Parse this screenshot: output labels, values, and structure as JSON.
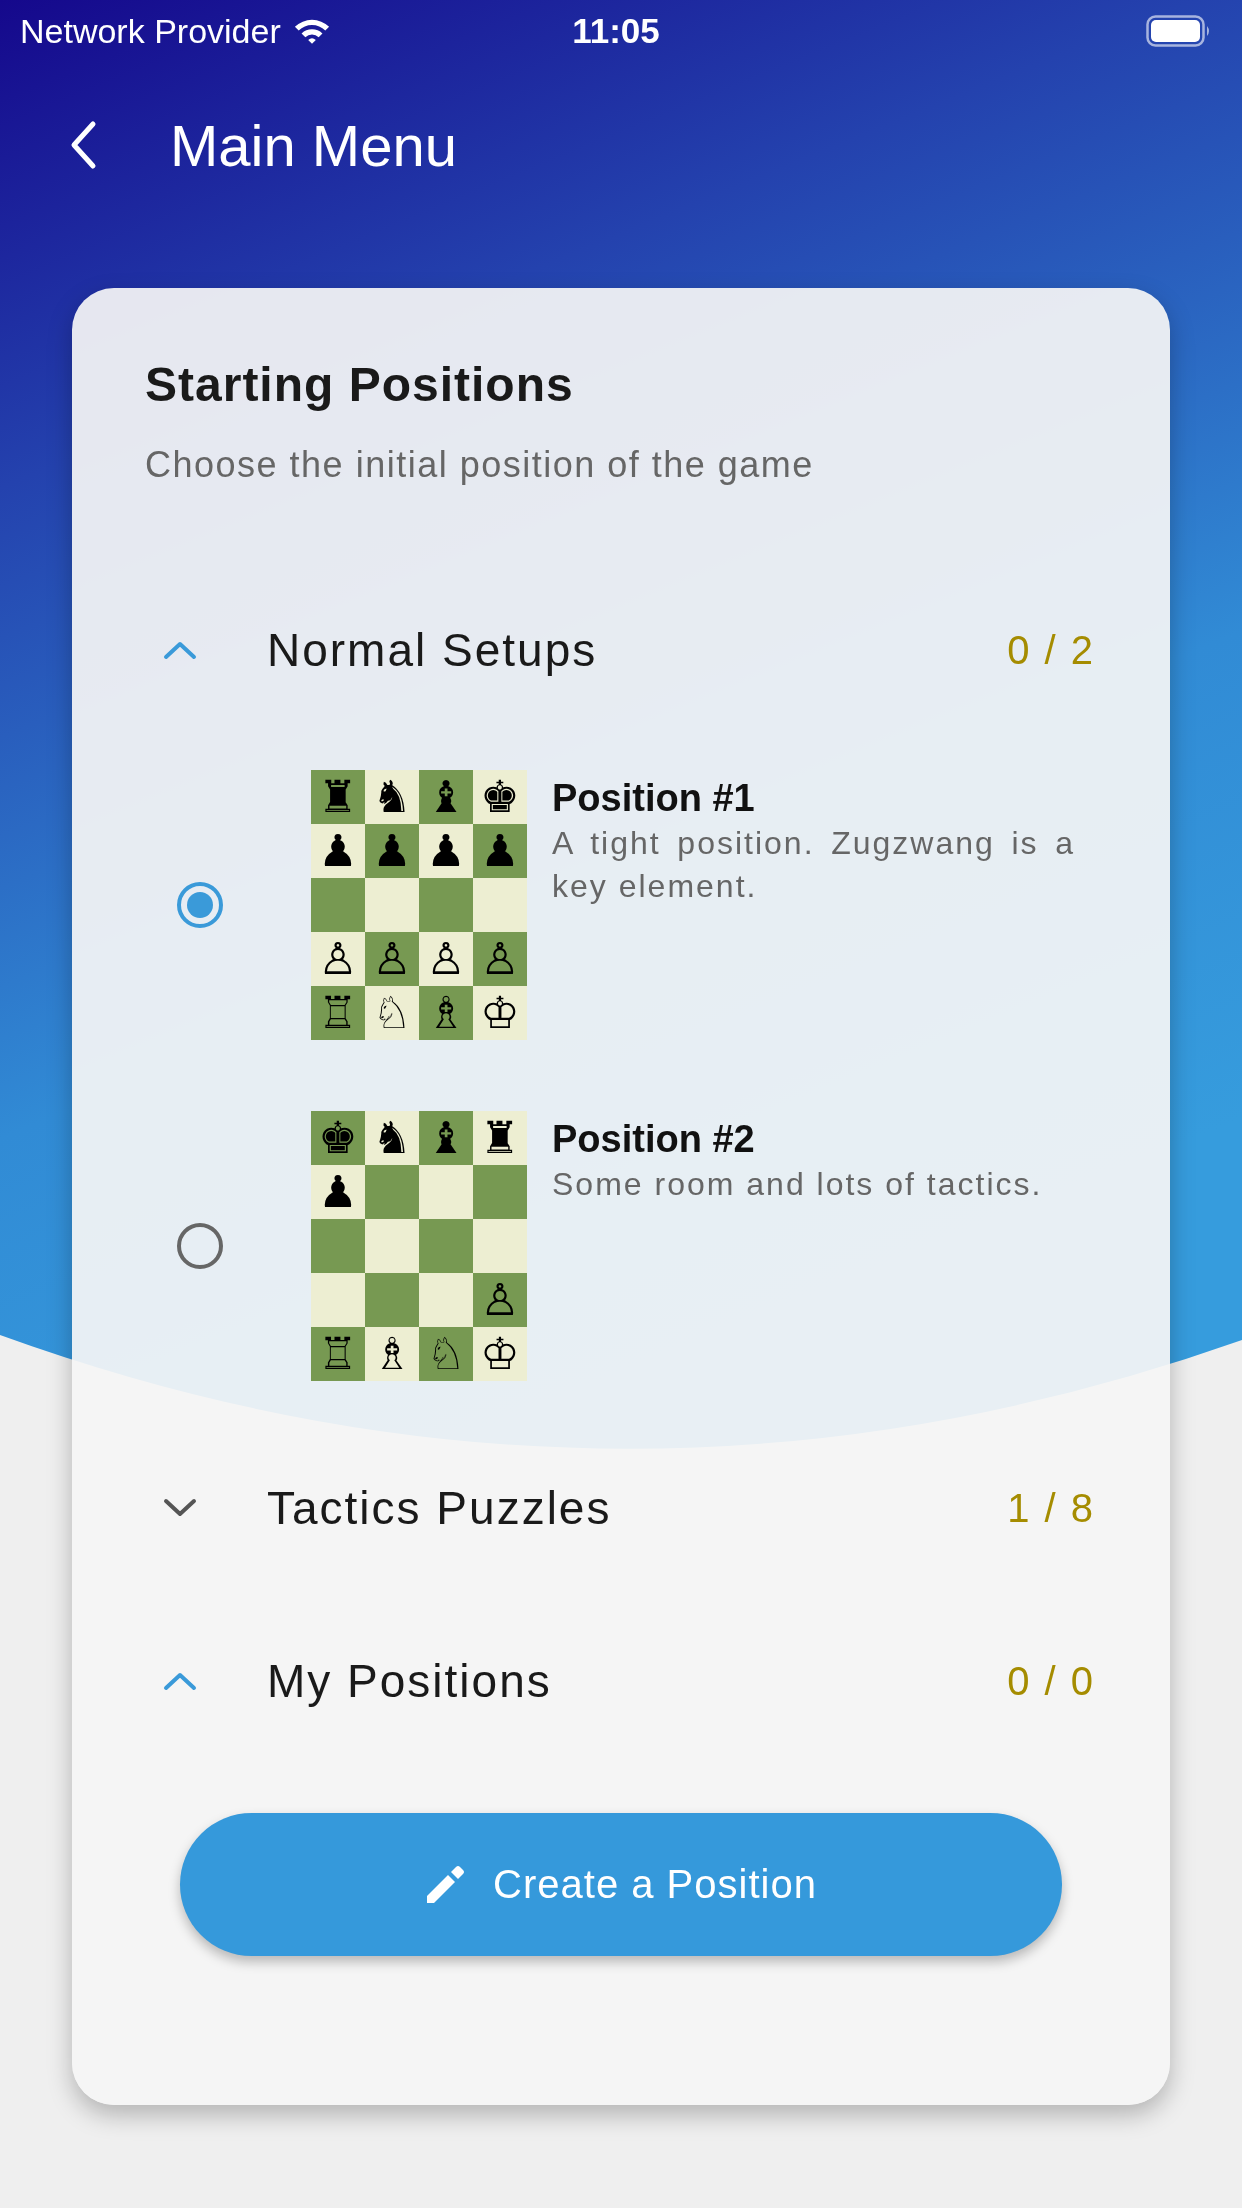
{
  "status_bar": {
    "carrier": "Network Provider",
    "time": "11:05"
  },
  "header": {
    "title": "Main Menu"
  },
  "card": {
    "title": "Starting Positions",
    "subtitle": "Choose the initial position of the game",
    "sections": [
      {
        "label": "Normal Setups",
        "count": "0 / 2",
        "expanded": true,
        "positions": [
          {
            "title": "Position #1",
            "description": "A tight position. Zugzwang is a key element.",
            "selected": true,
            "rows": [
              [
                "♜",
                "♞",
                "♝",
                "♚"
              ],
              [
                "♟",
                "♟",
                "♟",
                "♟"
              ],
              [
                null,
                null,
                null,
                null
              ],
              [
                "♙",
                "♙",
                "♙",
                "♙"
              ],
              [
                "♖",
                "♘",
                "♗",
                "♔"
              ]
            ]
          },
          {
            "title": "Position #2",
            "description": "Some room and lots of tactics.",
            "selected": false,
            "rows": [
              [
                "♚",
                "♞",
                "♝",
                "♜"
              ],
              [
                "♟",
                null,
                null,
                null
              ],
              [
                null,
                null,
                null,
                null
              ],
              [
                null,
                null,
                null,
                "♙"
              ],
              [
                "♖",
                "♗",
                "♘",
                "♔"
              ]
            ]
          }
        ]
      },
      {
        "label": "Tactics Puzzles",
        "count": "1 / 8",
        "expanded": false
      },
      {
        "label": "My Positions",
        "count": "0 / 0",
        "expanded": true
      }
    ],
    "button": {
      "label": "Create a Position"
    }
  }
}
